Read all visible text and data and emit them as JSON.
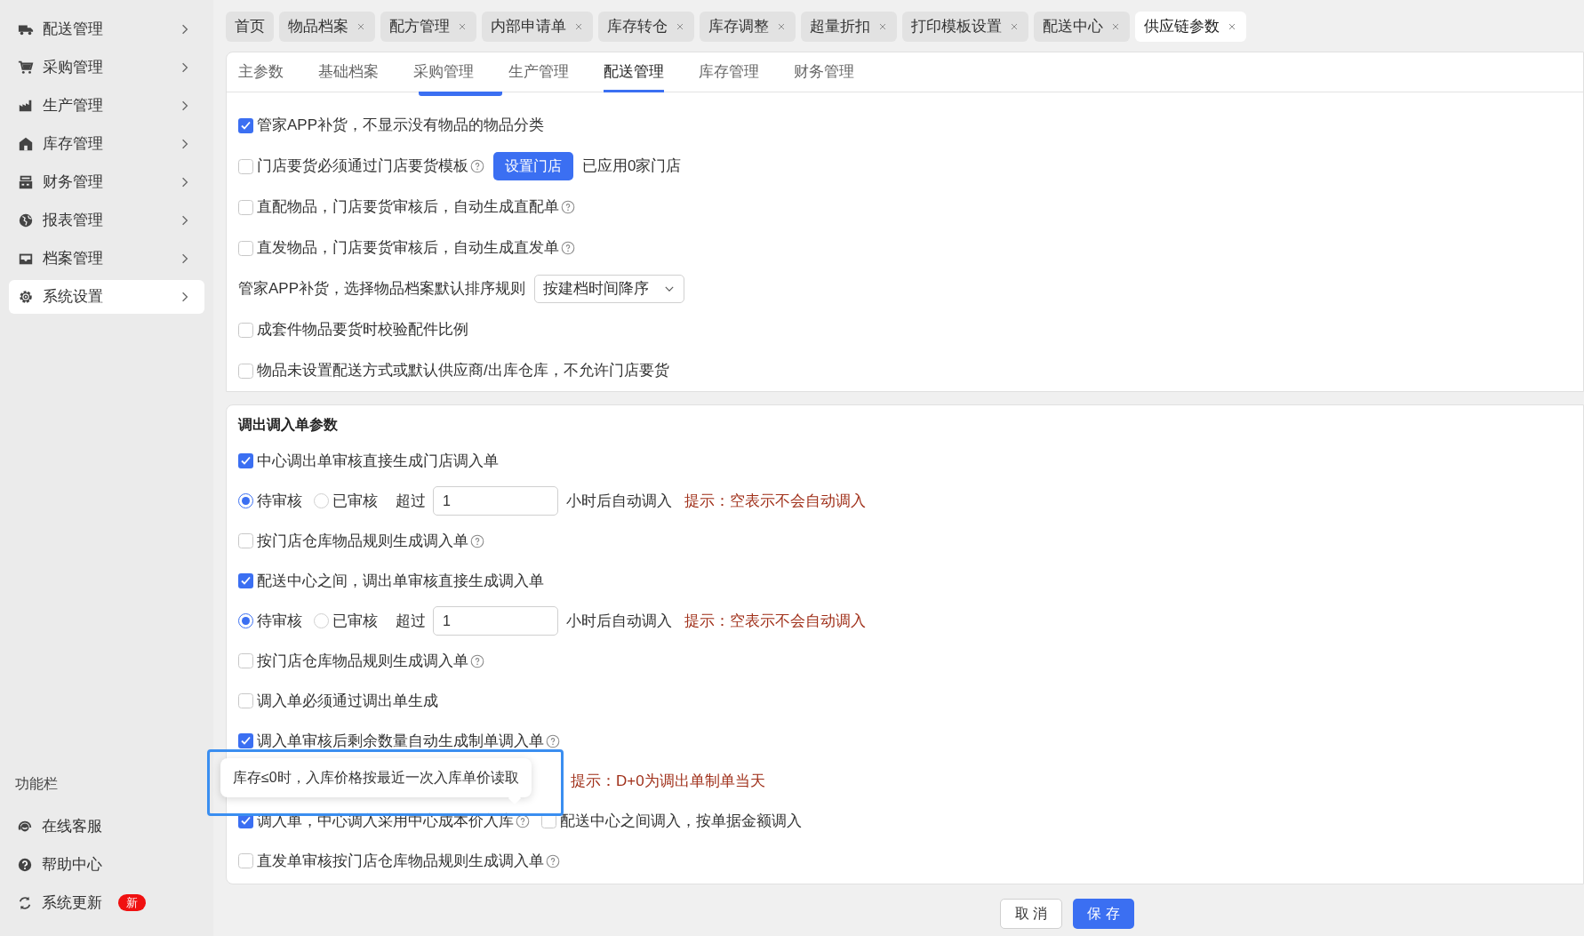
{
  "sidebar": {
    "items": [
      {
        "label": "配送管理",
        "selected": false
      },
      {
        "label": "采购管理",
        "selected": false
      },
      {
        "label": "生产管理",
        "selected": false
      },
      {
        "label": "库存管理",
        "selected": false
      },
      {
        "label": "财务管理",
        "selected": false
      },
      {
        "label": "报表管理",
        "selected": false
      },
      {
        "label": "档案管理",
        "selected": false
      },
      {
        "label": "系统设置",
        "selected": true
      }
    ],
    "section_title": "功能栏",
    "tools": [
      {
        "label": "在线客服"
      },
      {
        "label": "帮助中心"
      },
      {
        "label": "系统更新",
        "badge": "新"
      }
    ]
  },
  "open_tabs": [
    {
      "label": "首页",
      "closable": false,
      "selected": false
    },
    {
      "label": "物品档案",
      "closable": true,
      "selected": false
    },
    {
      "label": "配方管理",
      "closable": true,
      "selected": false
    },
    {
      "label": "内部申请单",
      "closable": true,
      "selected": false
    },
    {
      "label": "库存转仓",
      "closable": true,
      "selected": false
    },
    {
      "label": "库存调整",
      "closable": true,
      "selected": false
    },
    {
      "label": "超量折扣",
      "closable": true,
      "selected": false
    },
    {
      "label": "打印模板设置",
      "closable": true,
      "selected": false
    },
    {
      "label": "配送中心",
      "closable": true,
      "selected": false
    },
    {
      "label": "供应链参数",
      "closable": true,
      "selected": true
    }
  ],
  "settings_tabs": [
    {
      "label": "主参数",
      "selected": false
    },
    {
      "label": "基础档案",
      "selected": false
    },
    {
      "label": "采购管理",
      "selected": false
    },
    {
      "label": "生产管理",
      "selected": false
    },
    {
      "label": "配送管理",
      "selected": true
    },
    {
      "label": "库存管理",
      "selected": false
    },
    {
      "label": "财务管理",
      "selected": false
    }
  ],
  "sections": [
    {
      "rows": [
        {
          "kind": "checkbox",
          "label": "管家APP补货，不显示没有物品的物品分类",
          "checked": true
        },
        {
          "kind": "checkbox",
          "label": "门店要货必须通过门店要货模板",
          "checked": false,
          "help": true,
          "button": "设置门店",
          "note": "已应用0家门店"
        },
        {
          "kind": "checkbox",
          "label": "直配物品，门店要货审核后，自动生成直配单",
          "checked": false,
          "help": true
        },
        {
          "kind": "checkbox",
          "label": "直发物品，门店要货审核后，自动生成直发单",
          "checked": false,
          "help": true
        },
        {
          "kind": "select",
          "label": "管家APP补货，选择物品档案默认排序规则",
          "value": "按建档时间降序"
        },
        {
          "kind": "checkbox",
          "label": "成套件物品要货时校验配件比例",
          "checked": false
        },
        {
          "kind": "checkbox",
          "label": "物品未设置配送方式或默认供应商/出库仓库，不允许门店要货",
          "checked": false
        }
      ]
    },
    {
      "title": "调出调入单参数",
      "rows": [
        {
          "kind": "checkbox",
          "label": "中心调出单审核直接生成门店调入单",
          "checked": true
        },
        {
          "kind": "radio",
          "options": [
            {
              "label": "待审核",
              "selected": true
            },
            {
              "label": "已审核",
              "selected": false
            }
          ],
          "prefix": "超过",
          "value": "1",
          "suffix": "小时后自动调入",
          "tip": "提示：空表示不会自动调入"
        },
        {
          "kind": "checkbox",
          "label": "按门店仓库物品规则生成调入单",
          "checked": false,
          "help": true
        },
        {
          "kind": "checkbox",
          "label": "配送中心之间，调出单审核直接生成调入单",
          "checked": true
        },
        {
          "kind": "radio",
          "options": [
            {
              "label": "待审核",
              "selected": true
            },
            {
              "label": "已审核",
              "selected": false
            }
          ],
          "prefix": "超过",
          "value": "1",
          "suffix": "小时后自动调入",
          "tip": "提示：空表示不会自动调入"
        },
        {
          "kind": "checkbox",
          "label": "按门店仓库物品规则生成调入单",
          "checked": false,
          "help": true
        },
        {
          "kind": "checkbox",
          "label": "调入单必须通过调出单生成",
          "checked": false
        },
        {
          "kind": "checkbox",
          "label": "调入单审核后剩余数量自动生成制单调入单",
          "checked": true,
          "help": true
        },
        {
          "kind": "tip",
          "tip": "提示：D+0为调出单制单当天"
        },
        {
          "kind": "pair",
          "items": [
            {
              "label": "调入单，中心调入采用中心成本价入库",
              "checked": true,
              "help": true
            },
            {
              "label": "配送中心之间调入，按单据金额调入",
              "checked": false
            }
          ]
        },
        {
          "kind": "checkbox",
          "label": "直发单审核按门店仓库物品规则生成调入单",
          "checked": false,
          "help": true
        }
      ]
    }
  ],
  "tooltip": {
    "text": "库存≤0时，入库价格按最近一次入库单价读取"
  },
  "buttons": {
    "cancel": "取 消",
    "save": "保 存"
  }
}
